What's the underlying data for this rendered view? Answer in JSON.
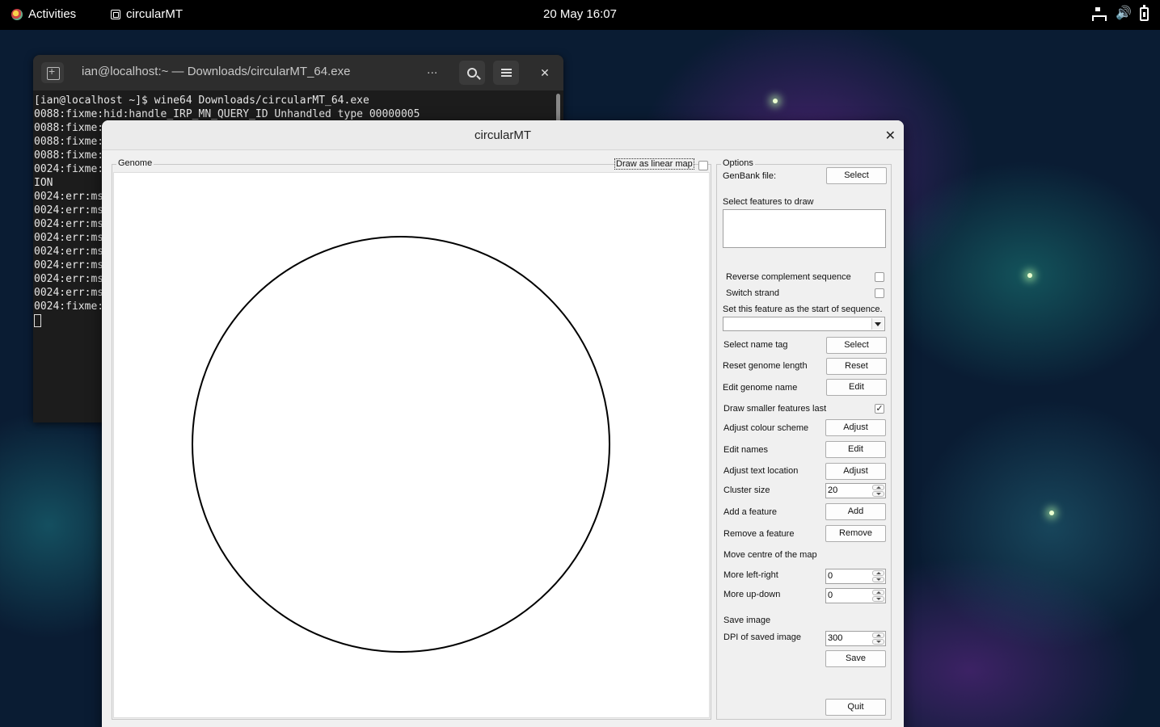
{
  "topbar": {
    "activities": "Activities",
    "app_name": "circularMT",
    "clock": "20 May  16:07"
  },
  "terminal": {
    "title": "ian@localhost:~ — Downloads/circularMT_64.exe",
    "menu_dots": "...",
    "lines": [
      "[ian@localhost ~]$ wine64 Downloads/circularMT_64.exe",
      "0088:fixme:hid:handle_IRP_MN_QUERY_ID Unhandled type 00000005",
      "0088:fixme:",
      "0088:fixme:",
      "0088:fixme:",
      "0024:fixme:",
      "ION",
      "0024:err:ms",
      "0024:err:ms",
      "0024:err:ms",
      "0024:err:ms",
      "0024:err:ms",
      "0024:err:ms",
      "0024:err:ms",
      "0024:err:ms",
      "0024:fixme:"
    ]
  },
  "window": {
    "title": "circularMT",
    "genome_group": "Genome",
    "draw_linear_label": "Draw as linear map",
    "draw_linear_checked": false,
    "options_group": "Options",
    "options": {
      "genbank_label": "GenBank file:",
      "genbank_button": "Select",
      "features_label": "Select features to draw",
      "reverse_label": "Reverse complement sequence",
      "switch_label": "Switch strand",
      "start_label": "Set this feature as the start of sequence.",
      "start_value": "",
      "name_tag_label": "Select name tag",
      "name_tag_button": "Select",
      "reset_label": "Reset genome length",
      "reset_button": "Reset",
      "edit_genome_label": "Edit genome name",
      "edit_genome_button": "Edit",
      "smaller_last_label": "Draw smaller features last",
      "smaller_last_checked": true,
      "colour_label": "Adjust colour scheme",
      "colour_button": "Adjust",
      "edit_names_label": "Edit names",
      "edit_names_button": "Edit",
      "text_loc_label": "Adjust text location",
      "text_loc_button": "Adjust",
      "cluster_label": "Cluster size",
      "cluster_value": "20",
      "add_feature_label": "Add a feature",
      "add_feature_button": "Add",
      "remove_feature_label": "Remove a feature",
      "remove_feature_button": "Remove",
      "move_centre_label": "Move centre of the map",
      "left_right_label": "More left-right",
      "left_right_value": "0",
      "up_down_label": "More up-down",
      "up_down_value": "0",
      "save_image_label": "Save image",
      "dpi_label": "DPI of saved image",
      "dpi_value": "300",
      "save_button": "Save",
      "quit_button": "Quit"
    }
  },
  "colors": {
    "topbar": "#000000",
    "window_bg": "#f0f0f0",
    "terminal_bg": "#1c1c1c"
  }
}
